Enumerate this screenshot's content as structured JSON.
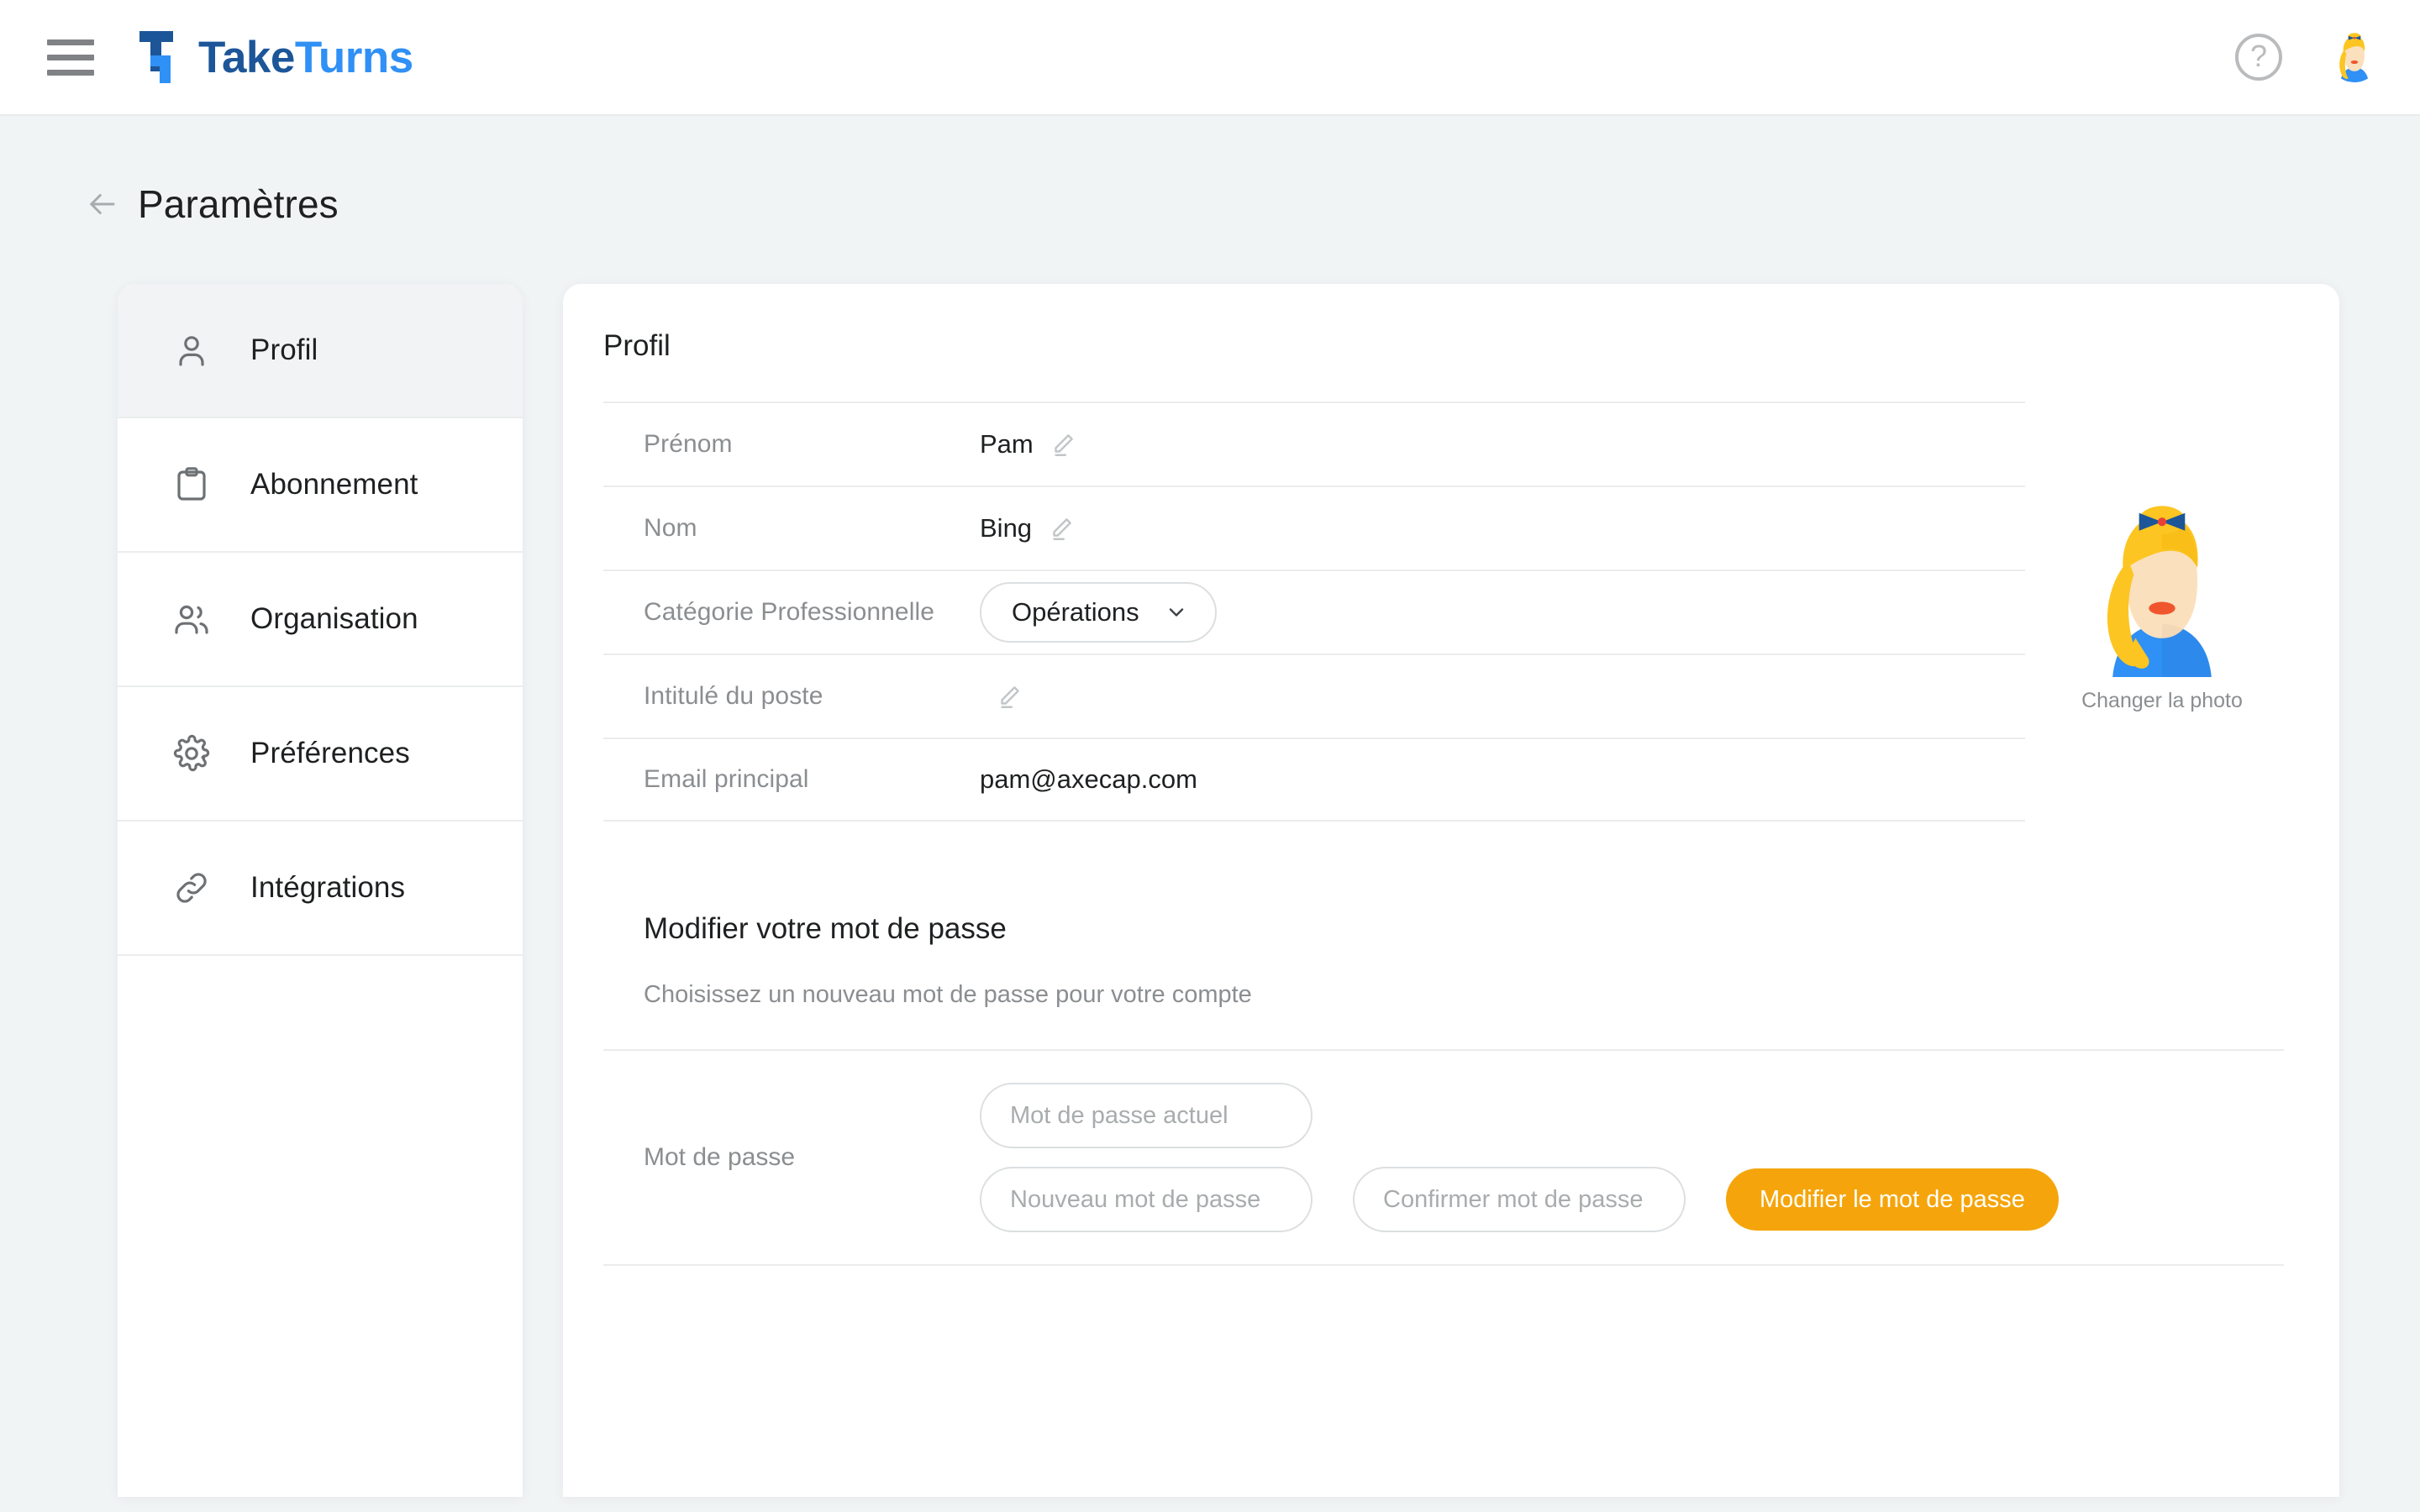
{
  "appbar": {
    "menu_icon": "hamburger-icon",
    "brand_take": "Take",
    "brand_turns": "Turns",
    "help_icon": "question-mark-icon",
    "help_label": "?",
    "avatar_icon": "user-avatar-icon"
  },
  "page": {
    "back_icon": "arrow-left-icon",
    "title": "Paramètres"
  },
  "sidebar": {
    "items": [
      {
        "label": "Profil",
        "icon": "user-icon",
        "active": true
      },
      {
        "label": "Abonnement",
        "icon": "clipboard-icon",
        "active": false
      },
      {
        "label": "Organisation",
        "icon": "users-icon",
        "active": false
      },
      {
        "label": "Préférences",
        "icon": "gear-icon",
        "active": false
      },
      {
        "label": "Intégrations",
        "icon": "link-icon",
        "active": false
      }
    ]
  },
  "profile": {
    "section_title": "Profil",
    "rows": {
      "prenom_label": "Prénom",
      "prenom_value": "Pam",
      "nom_label": "Nom",
      "nom_value": "Bing",
      "categorie_label": "Catégorie Professionnelle",
      "categorie_value": "Opérations",
      "categorie_options": [
        "Opérations"
      ],
      "poste_label": "Intitulé du poste",
      "poste_value": "",
      "email_label": "Email principal",
      "email_value": "pam@axecap.com"
    },
    "edit_icon": "pencil-icon",
    "chevron_icon": "chevron-down-icon",
    "photo": {
      "avatar_icon": "user-avatar-icon",
      "change_label": "Changer la photo"
    }
  },
  "password": {
    "title": "Modifier votre mot de passe",
    "subtitle": "Choisissez un nouveau mot de passe pour votre compte",
    "label": "Mot de passe",
    "current_placeholder": "Mot de passe actuel",
    "current_value": "",
    "new_placeholder": "Nouveau mot de passe",
    "new_value": "",
    "confirm_placeholder": "Confirmer mot de passe",
    "confirm_value": "",
    "submit_label": "Modifier le mot de passe"
  },
  "colors": {
    "brand_dark": "#1c5699",
    "brand_light": "#2f90f5",
    "accent_orange": "#f5a50b",
    "page_bg": "#f1f4f5",
    "card_bg": "#ffffff",
    "active_nav_bg": "#f2f3f4"
  }
}
